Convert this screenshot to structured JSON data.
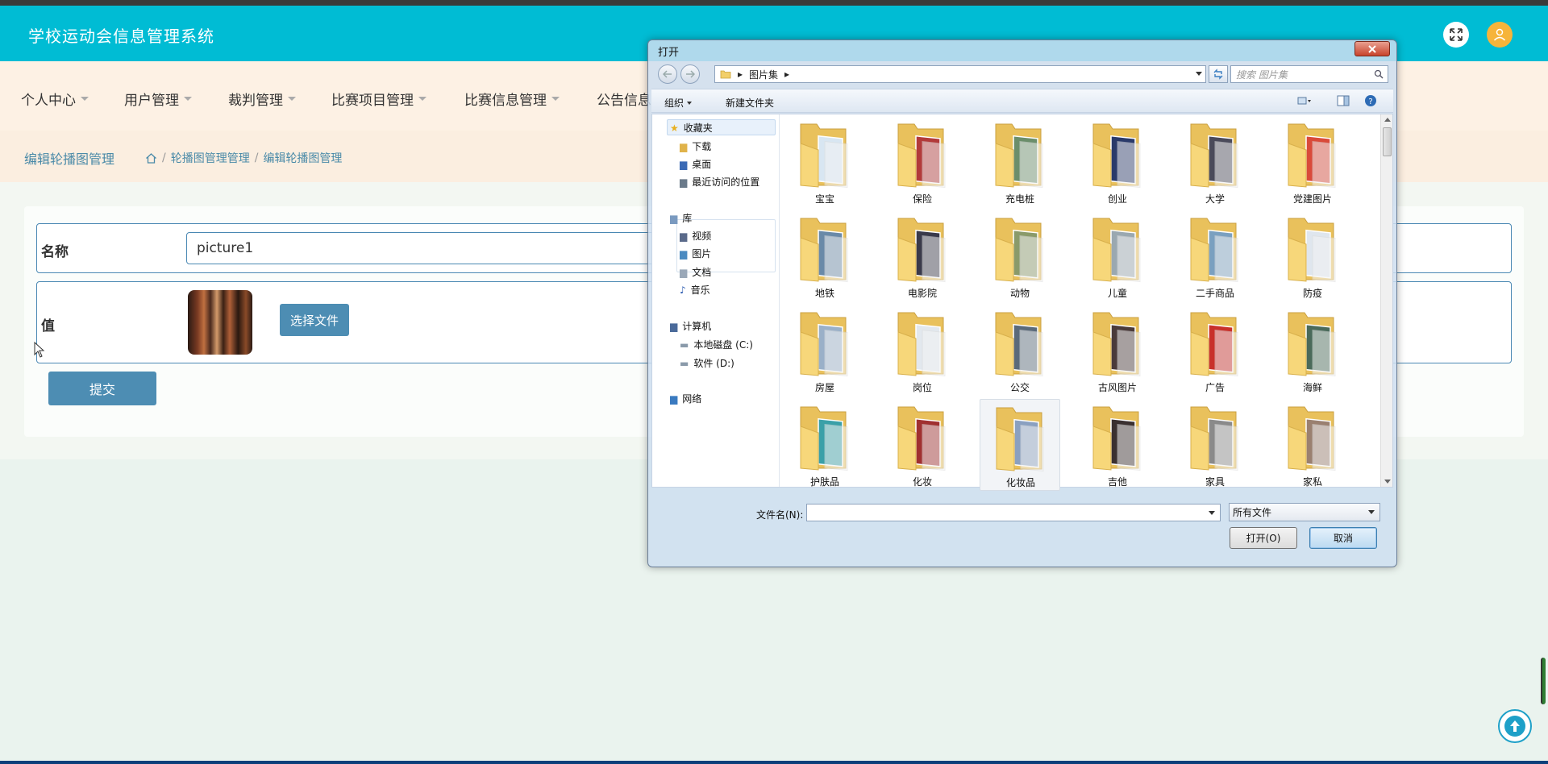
{
  "app": {
    "title": "学校运动会信息管理系统"
  },
  "nav": {
    "items": [
      {
        "label": "个人中心"
      },
      {
        "label": "用户管理"
      },
      {
        "label": "裁判管理"
      },
      {
        "label": "比赛项目管理"
      },
      {
        "label": "比赛信息管理"
      },
      {
        "label": "公告信息管理"
      }
    ]
  },
  "breadcrumb": {
    "title": "编辑轮播图管理",
    "items": [
      "轮播图管理管理",
      "编辑轮播图管理"
    ]
  },
  "form": {
    "name_label": "名称",
    "name_value": "picture1",
    "value_label": "值",
    "choose_label": "选择文件",
    "submit_label": "提交"
  },
  "dialog": {
    "title": "打开",
    "path": "图片集",
    "search_placeholder": "搜索 图片集",
    "toolbar": {
      "organize": "组织",
      "new_folder": "新建文件夹"
    },
    "nav_pane": {
      "favorites": "收藏夹",
      "downloads": "下载",
      "desktop": "桌面",
      "recent": "最近访问的位置",
      "libraries": "库",
      "videos": "视频",
      "pictures": "图片",
      "documents": "文档",
      "music": "音乐",
      "computer": "计算机",
      "disk_c": "本地磁盘 (C:)",
      "disk_d": "软件 (D:)",
      "network": "网络"
    },
    "folders": [
      {
        "label": "宝宝",
        "color": "#d8e6f2"
      },
      {
        "label": "保险",
        "color": "#b23a3a"
      },
      {
        "label": "充电桩",
        "color": "#6b8e6b"
      },
      {
        "label": "创业",
        "color": "#2a3a6a"
      },
      {
        "label": "大学",
        "color": "#4a4a5a"
      },
      {
        "label": "党建图片",
        "color": "#d94a3a"
      },
      {
        "label": "地铁",
        "color": "#6a8aa8"
      },
      {
        "label": "电影院",
        "color": "#3a3a4a"
      },
      {
        "label": "动物",
        "color": "#8a9a6a"
      },
      {
        "label": "儿童",
        "color": "#9aa8b0"
      },
      {
        "label": "二手商品",
        "color": "#7aa0c0"
      },
      {
        "label": "防疫",
        "color": "#dfe6ee"
      },
      {
        "label": "房屋",
        "color": "#9ab0c8"
      },
      {
        "label": "岗位",
        "color": "#e2e8ee"
      },
      {
        "label": "公交",
        "color": "#5a6a7a"
      },
      {
        "label": "古风图片",
        "color": "#4a3a3a"
      },
      {
        "label": "广告",
        "color": "#c8302a"
      },
      {
        "label": "海鲜",
        "color": "#4a6a5a"
      },
      {
        "label": "护肤品",
        "color": "#3aa0a8"
      },
      {
        "label": "化妆",
        "color": "#a03030"
      },
      {
        "label": "化妆品",
        "color": "#8aa0c0"
      },
      {
        "label": "吉他",
        "color": "#3a3030"
      },
      {
        "label": "家具",
        "color": "#8a8a8a"
      },
      {
        "label": "家私",
        "color": "#9a8070"
      }
    ],
    "filename_label": "文件名(N):",
    "filename_value": "",
    "filetype": "所有文件",
    "open_label": "打开(O)",
    "cancel_label": "取消"
  }
}
